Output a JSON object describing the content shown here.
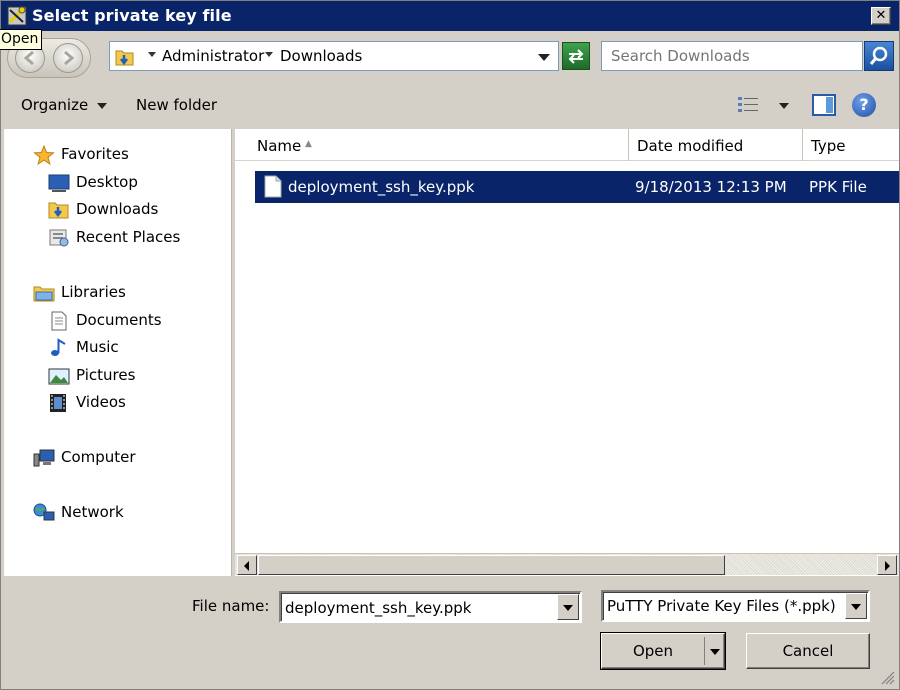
{
  "window": {
    "title": "Select private key file",
    "tooltip": "Open",
    "close_label": "✕"
  },
  "address": {
    "crumbs": [
      "Administrator",
      "Downloads"
    ],
    "search_placeholder": "Search Downloads"
  },
  "toolbar": {
    "organize_label": "Organize",
    "new_folder_label": "New folder",
    "help_label": "?"
  },
  "nav": {
    "favorites": "Favorites",
    "desktop": "Desktop",
    "downloads": "Downloads",
    "recent_places": "Recent Places",
    "libraries": "Libraries",
    "documents": "Documents",
    "music": "Music",
    "pictures": "Pictures",
    "videos": "Videos",
    "computer": "Computer",
    "network": "Network"
  },
  "columns": {
    "name": "Name",
    "date_modified": "Date modified",
    "type": "Type"
  },
  "files": [
    {
      "name": "deployment_ssh_key.ppk",
      "date_modified": "9/18/2013 12:13 PM",
      "type": "PPK File",
      "selected": true
    }
  ],
  "bottom": {
    "file_name_label": "File name:",
    "file_name_value": "deployment_ssh_key.ppk",
    "filter_value": "PuTTY Private Key Files (*.ppk)",
    "open_label": "Open",
    "cancel_label": "Cancel"
  },
  "colors": {
    "titlebar": "#0a246a",
    "selection": "#0a246a",
    "face": "#d4d0c8"
  }
}
